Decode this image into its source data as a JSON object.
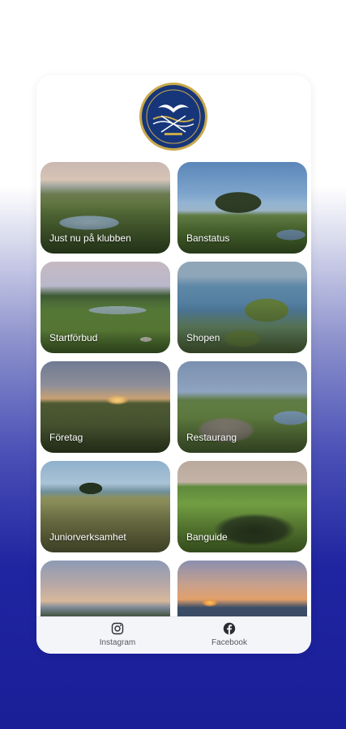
{
  "tiles": [
    {
      "label": "Just nu på klubben"
    },
    {
      "label": "Banstatus"
    },
    {
      "label": "Startförbud"
    },
    {
      "label": "Shopen"
    },
    {
      "label": "Företag"
    },
    {
      "label": "Restaurang"
    },
    {
      "label": "Juniorverksamhet"
    },
    {
      "label": "Banguide"
    },
    {
      "label": ""
    },
    {
      "label": ""
    }
  ],
  "bottom_nav": {
    "instagram_label": "Instagram",
    "facebook_label": "Facebook"
  },
  "colors": {
    "background_bottom": "#1a1f98",
    "logo_navy": "#17367a",
    "logo_gold": "#c9a94a"
  },
  "icons": [
    "club-logo",
    "instagram-icon",
    "facebook-icon"
  ]
}
